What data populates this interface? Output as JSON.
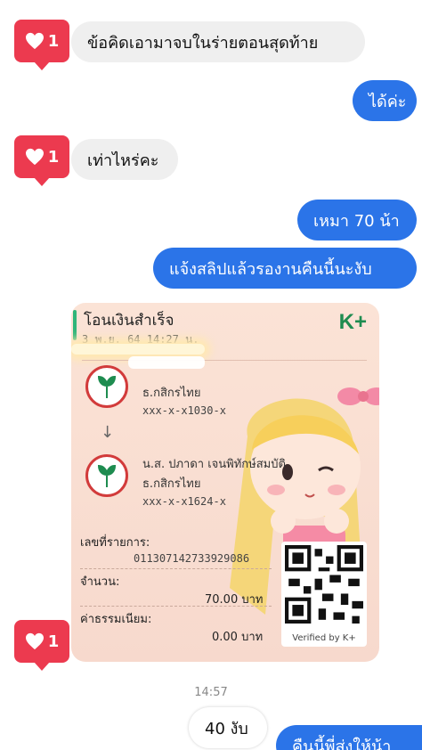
{
  "messages": [
    {
      "side": "in",
      "text": "ข้อคิดเอามาจบในร่ายตอนสุดท้าย"
    },
    {
      "side": "out",
      "text": "ได้ค่ะ"
    },
    {
      "side": "in",
      "text": "เท่าไหร่คะ"
    },
    {
      "side": "out",
      "text": "เหมา 70 น้า"
    },
    {
      "side": "out",
      "text": "แจ้งสลิปแล้วรองานคืนนี้นะงับ"
    },
    {
      "side": "in",
      "text": "40 งับ"
    },
    {
      "side": "out",
      "text": "คืนนี้พี่ส่งให้น้า"
    }
  ],
  "likes": [
    "1",
    "1",
    "1"
  ],
  "slip": {
    "title": "โอนเงินสำเร็จ",
    "datetime": "3 พ.ย. 64  14:27 น.",
    "brand_k": "K",
    "brand_plus": "+",
    "sender_bank": "ธ.กสิกรไทย",
    "sender_account": "xxx-x-x1030-x",
    "arrow": "↓",
    "receiver_name": "น.ส. ปภาดา เจนพิทักษ์สมบัติ",
    "receiver_bank": "ธ.กสิกรไทย",
    "receiver_account": "xxx-x-x1624-x",
    "ref_label": "เลขที่รายการ:",
    "ref_value": "011307142733929086",
    "amount_label": "จำนวน:",
    "amount_value": "70.00 บาท",
    "fee_label": "ค่าธรรมเนียม:",
    "fee_value": "0.00 บาท",
    "verified": "Verified by K+"
  },
  "timestamp": "14:57",
  "colors": {
    "outgoing": "#2b74e8",
    "incoming": "#efefef",
    "like": "#ec3a4f",
    "kbank_green": "#1e8c50"
  }
}
